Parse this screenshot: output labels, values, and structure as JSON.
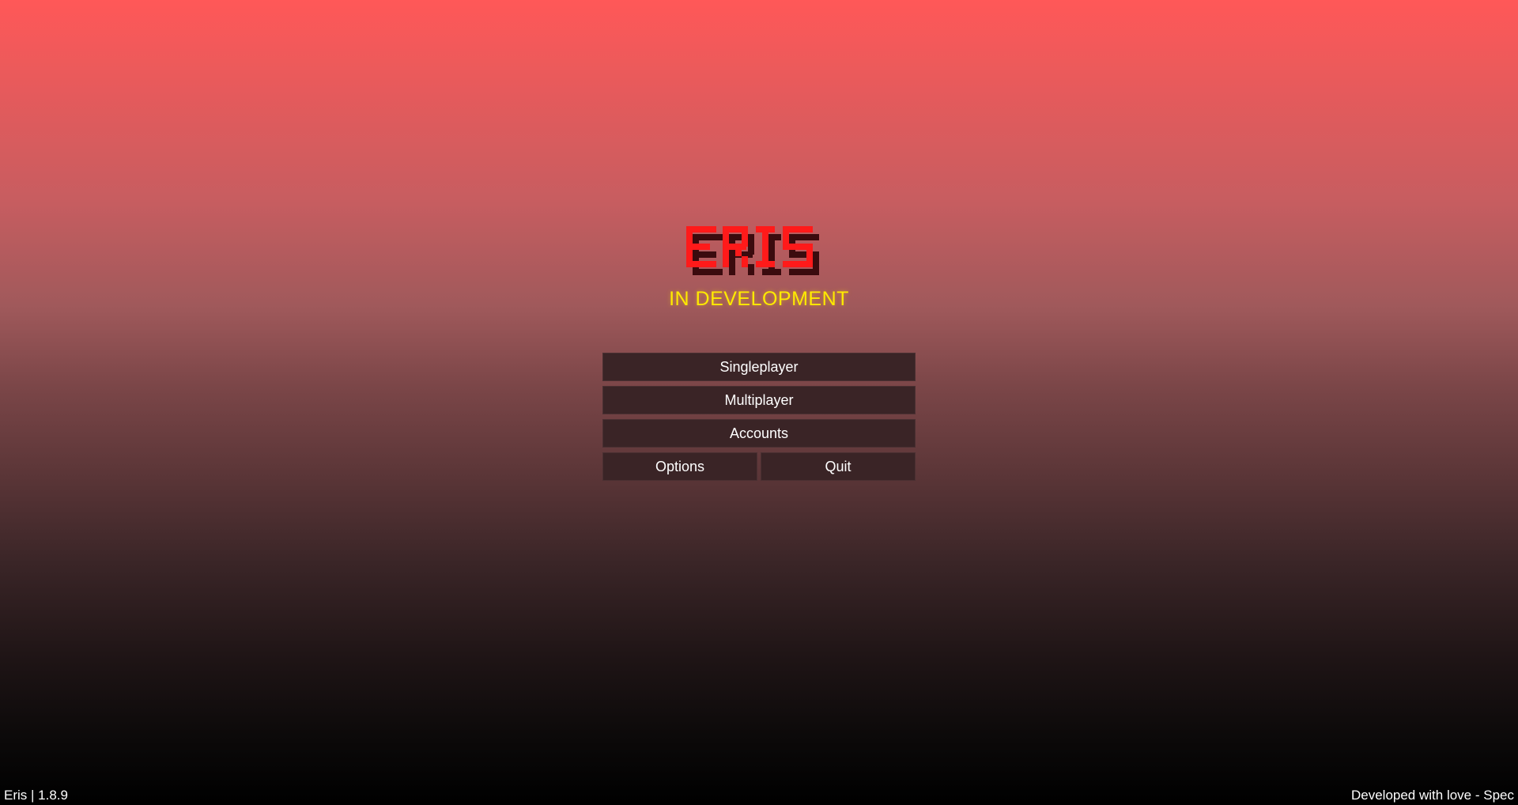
{
  "logo": {
    "text": "ERIS",
    "color_front": "#ff1a1a",
    "color_shadow": "#3b0b0e"
  },
  "subtitle": "IN DEVELOPMENT",
  "menu": {
    "singleplayer": "Singleplayer",
    "multiplayer": "Multiplayer",
    "accounts": "Accounts",
    "options": "Options",
    "quit": "Quit"
  },
  "footer": {
    "version": "Eris | 1.8.9",
    "credit": "Developed with love - Spec"
  },
  "colors": {
    "button_bg": "#3a2426",
    "subtitle": "#ffea00",
    "gradient_top": "#ff5858",
    "gradient_bottom": "#000000"
  }
}
